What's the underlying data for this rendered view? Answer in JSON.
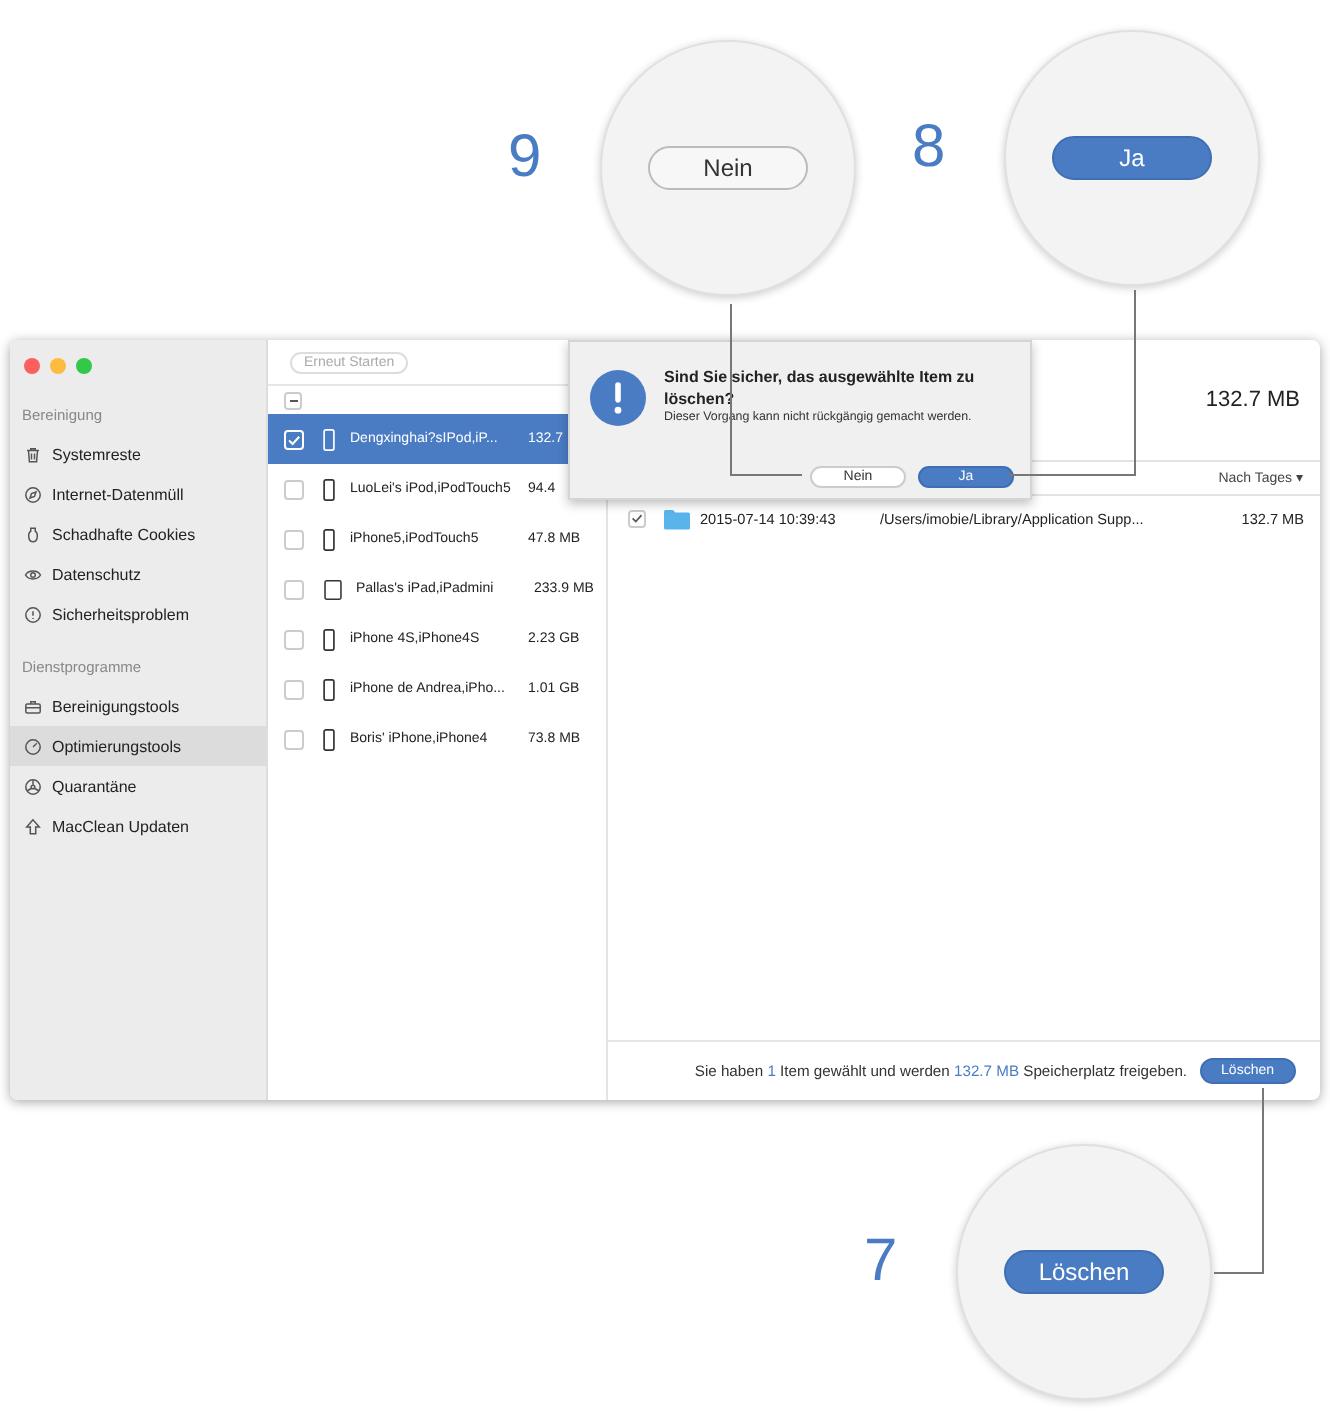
{
  "callouts": [
    {
      "number": "9",
      "kind": "plain",
      "label": "Nein"
    },
    {
      "number": "8",
      "kind": "primary",
      "label": "Ja"
    },
    {
      "number": "7",
      "kind": "primary",
      "label": "Löschen"
    }
  ],
  "toolbar": {
    "button": "Erneut Starten",
    "disabled": true
  },
  "sidebar": {
    "sections": [
      {
        "title": "Bereinigung",
        "items": [
          {
            "label": "Systemreste",
            "selected": false
          },
          {
            "label": "Internet-Datenmüll",
            "selected": false
          },
          {
            "label": "Schadhafte Cookies",
            "selected": false
          },
          {
            "label": "Datenschutz",
            "selected": false
          },
          {
            "label": "Sicherheitsproblem",
            "selected": false
          }
        ]
      },
      {
        "title": "Dienstprogramme",
        "items": [
          {
            "label": "Bereinigungstools",
            "selected": false
          },
          {
            "label": "Optimierungstools",
            "selected": true
          },
          {
            "label": "Quarantäne",
            "selected": false
          },
          {
            "label": "MacClean Updaten",
            "selected": false
          }
        ]
      }
    ]
  },
  "devices": {
    "mixed": true,
    "rows": [
      {
        "name": "Dengxinghai?sIPod,iP...",
        "size": "132.7",
        "kind": "phone",
        "checked": true,
        "selected": true
      },
      {
        "name": "LuoLei's iPod,iPodTouch5",
        "size": "94.4",
        "kind": "phone",
        "checked": false,
        "selected": false
      },
      {
        "name": "iPhone5,iPodTouch5",
        "size": "47.8 MB",
        "kind": "phone",
        "checked": false,
        "selected": false
      },
      {
        "name": "Pallas's iPad,iPadmini",
        "size": "233.9 MB",
        "kind": "tablet",
        "checked": false,
        "selected": false
      },
      {
        "name": "iPhone 4S,iPhone4S",
        "size": "2.23 GB",
        "kind": "phone",
        "checked": false,
        "selected": false
      },
      {
        "name": "iPhone de Andrea,iPho...",
        "size": "1.01 GB",
        "kind": "phone",
        "checked": false,
        "selected": false
      },
      {
        "name": "Boris' iPhone,iPhone4",
        "size": "73.8 MB",
        "kind": "phone",
        "checked": false,
        "selected": false
      }
    ]
  },
  "details": {
    "total": "132.7 MB",
    "sort": "Nach Tages ▾",
    "files": [
      {
        "date": "2015-07-14 10:39:43",
        "path": "/Users/imobie/Library/Application Supp...",
        "size": "132.7 MB",
        "checked": true
      }
    ]
  },
  "footer": {
    "text_1": "Sie haben",
    "count": "1",
    "text_2": "Item gewählt und werden",
    "amount": "132.7 MB",
    "text_3": "Speicherplatz freigeben.",
    "button": "Löschen"
  },
  "dialog": {
    "title": "Sind Sie sicher, das ausgewählte Item zu löschen?",
    "message": "Dieser Vorgang kann nicht rückgängig gemacht werden.",
    "buttons": [
      {
        "label": "Nein",
        "kind": "plain"
      },
      {
        "label": "Ja",
        "kind": "primary"
      }
    ]
  }
}
